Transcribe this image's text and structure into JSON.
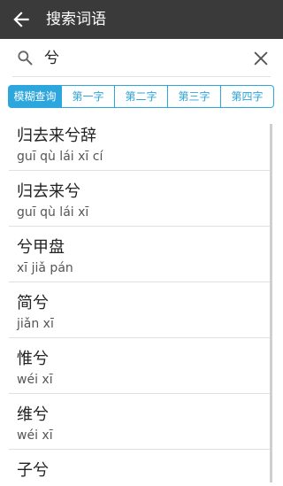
{
  "header": {
    "title": "搜索词语"
  },
  "search": {
    "query": "兮"
  },
  "tabs": [
    {
      "label": "模糊查询",
      "active": true
    },
    {
      "label": "第一字",
      "active": false
    },
    {
      "label": "第二字",
      "active": false
    },
    {
      "label": "第三字",
      "active": false
    },
    {
      "label": "第四字",
      "active": false
    }
  ],
  "results": [
    {
      "word": "归去来兮辞",
      "pinyin": "guī qù lái xī cí"
    },
    {
      "word": "归去来兮",
      "pinyin": "guī qù lái xī"
    },
    {
      "word": "兮甲盘",
      "pinyin": "xī jiǎ pán"
    },
    {
      "word": "简兮",
      "pinyin": "jiǎn xī"
    },
    {
      "word": "惟兮",
      "pinyin": "wéi xī"
    },
    {
      "word": "维兮",
      "pinyin": "wéi xī"
    },
    {
      "word": "子兮",
      "pinyin": ""
    }
  ],
  "colors": {
    "accent": "#2ca6dd",
    "topbar": "#3a3a3a"
  }
}
